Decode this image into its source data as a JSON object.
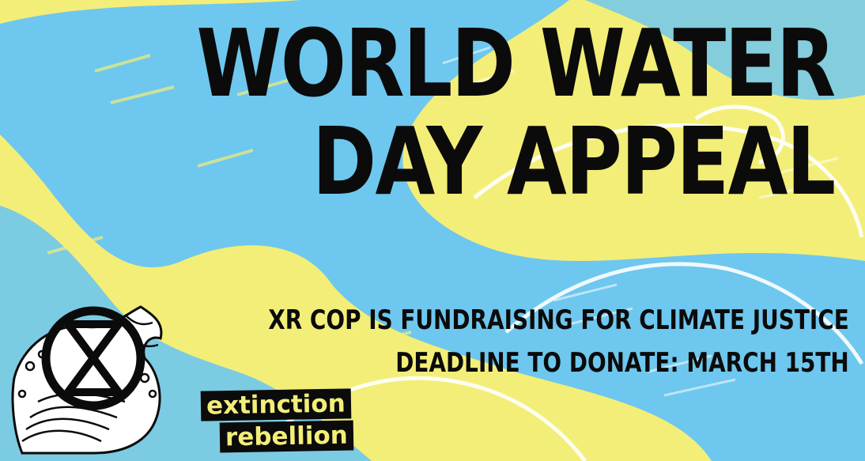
{
  "poster": {
    "title_line1": "WORLD WATER",
    "title_line2": "DAY APPEAL",
    "subtitle_line1": "XR COP IS FUNDRAISING FOR CLIMATE JUSTICE",
    "subtitle_line2": "DEADLINE TO DONATE: MARCH 15TH",
    "brand_line1": "extinction",
    "brand_line2": "rebellion"
  },
  "colors": {
    "yellow": "#f3ee78",
    "sky_blue": "#6ec7ee",
    "ink": "#0b0b0b",
    "white": "#ffffff"
  },
  "icons": [
    "extinction-symbol-icon",
    "ocean-wave-icon"
  ]
}
